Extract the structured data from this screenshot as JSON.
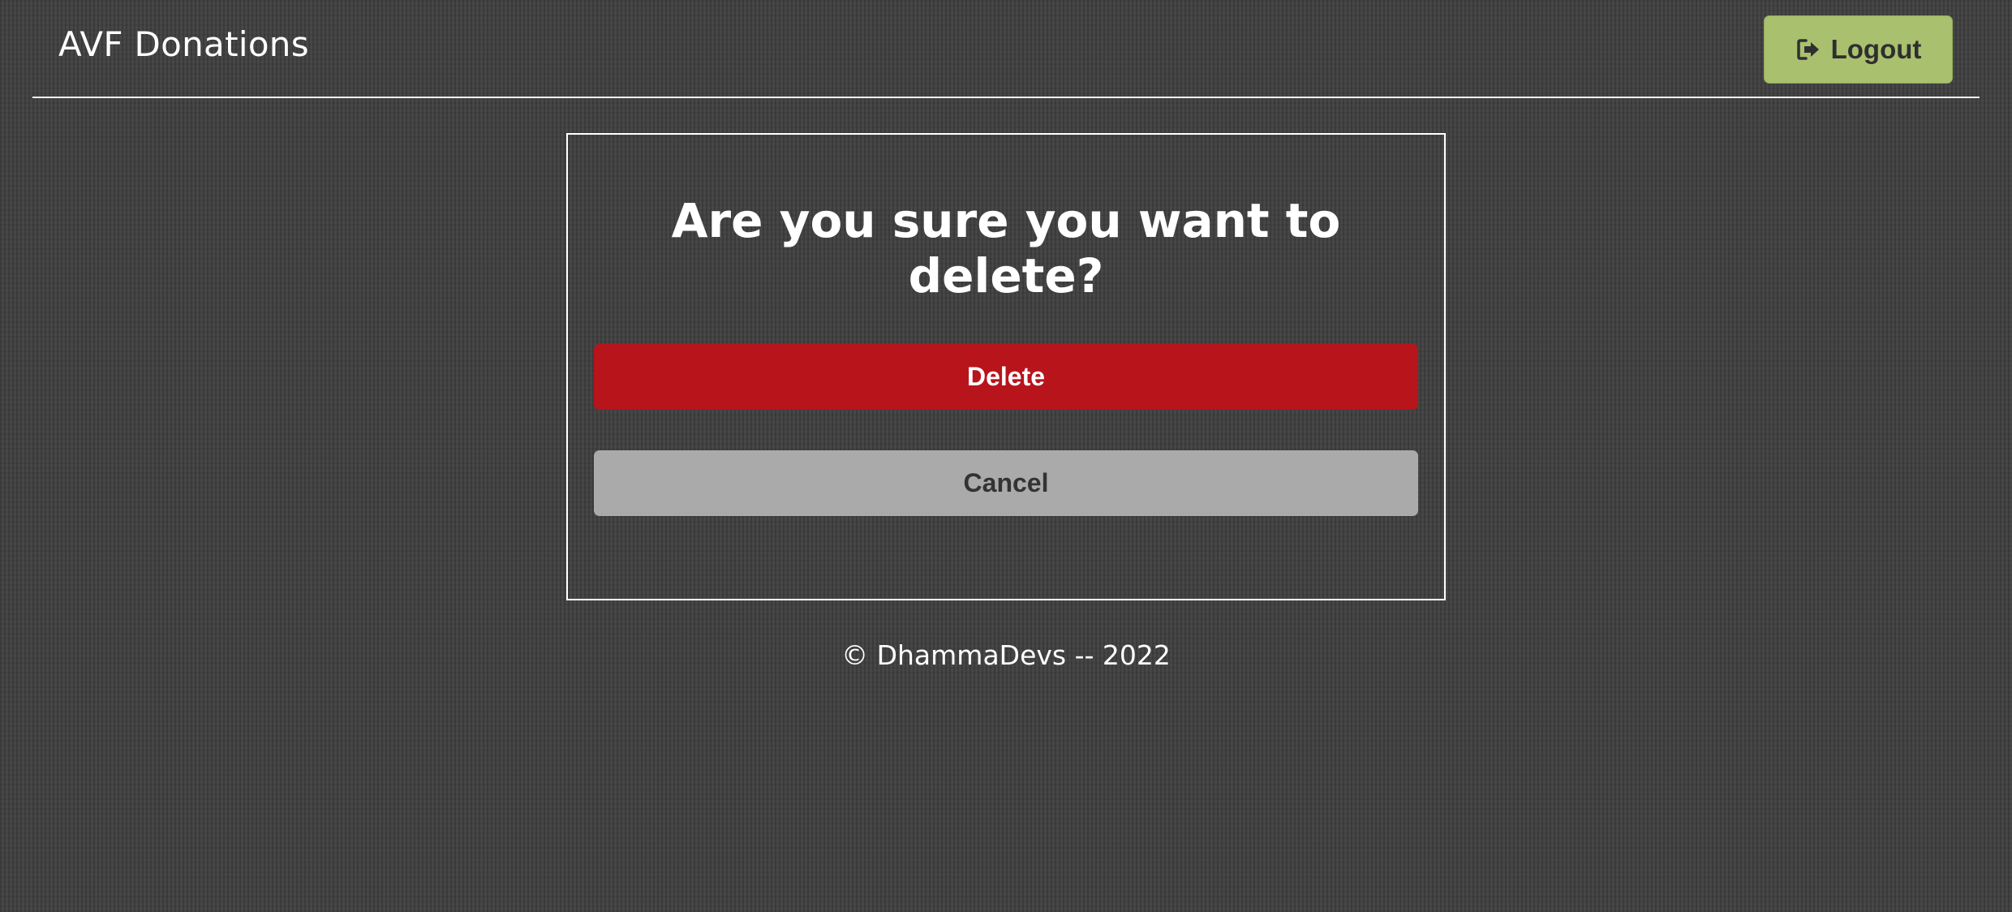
{
  "header": {
    "brand": "AVF Donations",
    "logout_label": "Logout",
    "logout_icon": "logout-icon"
  },
  "dialog": {
    "title": "Are you sure you want to delete?",
    "delete_label": "Delete",
    "cancel_label": "Cancel"
  },
  "footer": {
    "text": "© DhammaDevs -- 2022"
  },
  "colors": {
    "background": "#434343",
    "logout_button": "#a9c06f",
    "delete_button": "#b8141c",
    "cancel_button": "#aaaaaa"
  }
}
